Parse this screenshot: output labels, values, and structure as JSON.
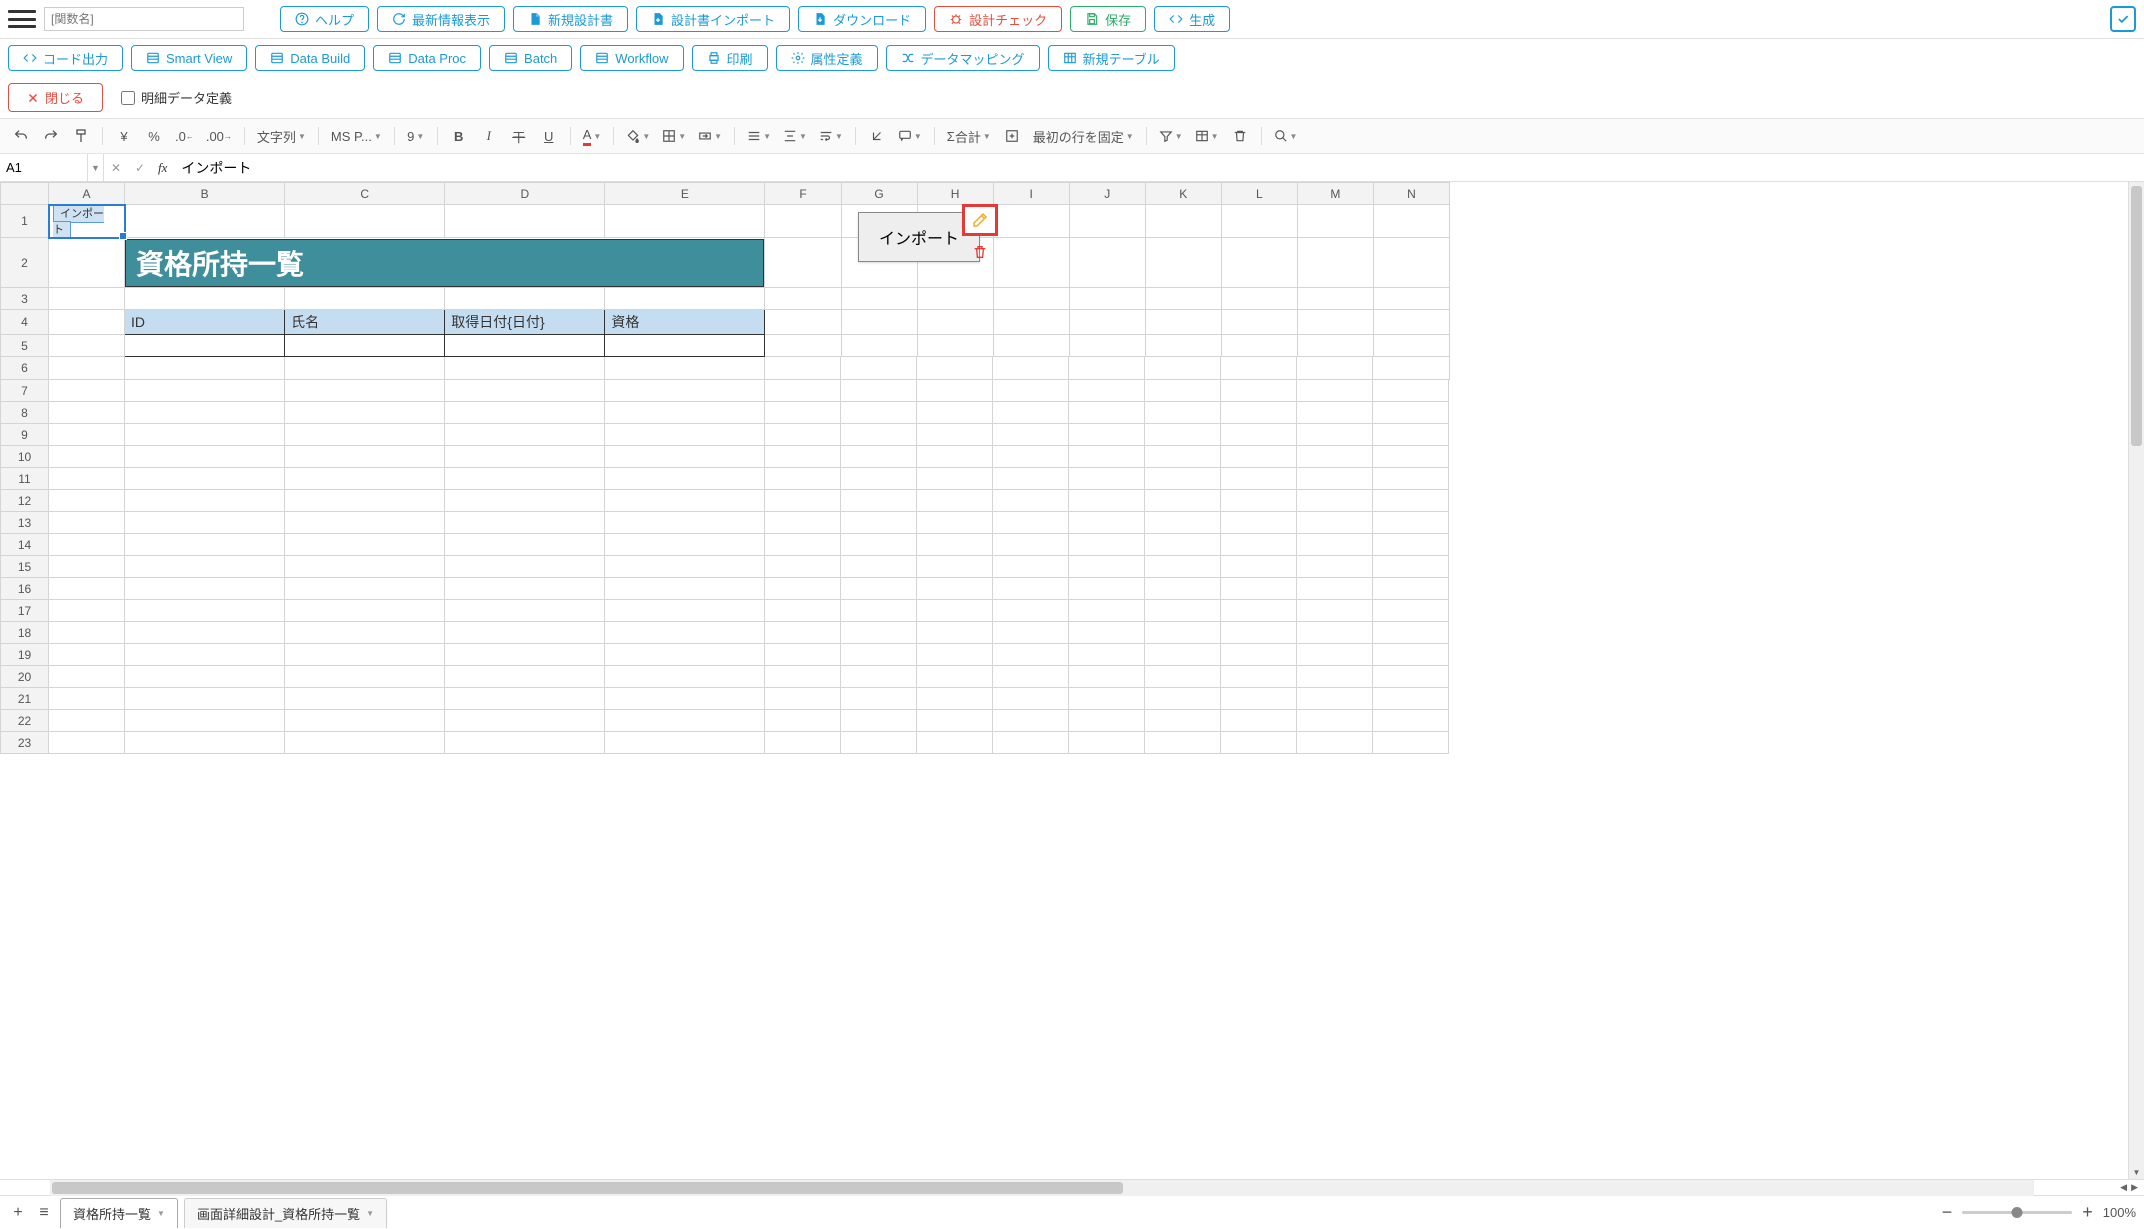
{
  "top": {
    "func_placeholder": "[関数名]",
    "buttons": {
      "help": "ヘルプ",
      "latest": "最新情報表示",
      "new_design": "新規設計書",
      "import_design": "設計書インポート",
      "download": "ダウンロード",
      "design_check": "設計チェック",
      "save": "保存",
      "generate": "生成"
    }
  },
  "row2": {
    "code_out": "コード出力",
    "smart_view": "Smart View",
    "data_build": "Data Build",
    "data_proc": "Data Proc",
    "batch": "Batch",
    "workflow": "Workflow",
    "print": "印刷",
    "attr_def": "属性定義",
    "data_mapping": "データマッピング",
    "new_table": "新規テーブル"
  },
  "row3": {
    "close": "閉じる",
    "detail_def": "明細データ定義"
  },
  "format": {
    "type_select": "文字列",
    "font": "MS P...",
    "size": "9",
    "sum": "合計",
    "freeze": "最初の行を固定"
  },
  "namebox": {
    "cell": "A1",
    "formula": "インポート"
  },
  "columns": [
    "A",
    "B",
    "C",
    "D",
    "E",
    "F",
    "G",
    "H",
    "I",
    "J",
    "K",
    "L",
    "M",
    "N"
  ],
  "rows": [
    1,
    2,
    3,
    4,
    5,
    6,
    7,
    8,
    9,
    10,
    11,
    12,
    13,
    14,
    15,
    16,
    17,
    18,
    19,
    20,
    21,
    22,
    23
  ],
  "sheet": {
    "a1": "インポート",
    "title": "資格所持一覧",
    "headers": {
      "id": "ID",
      "name": "氏名",
      "date": "取得日付{日付}",
      "qual": "資格"
    },
    "import_btn": "インポート"
  },
  "tabs": {
    "t1": "資格所持一覧",
    "t2": "画面詳細設計_資格所持一覧"
  },
  "zoom": "100%"
}
